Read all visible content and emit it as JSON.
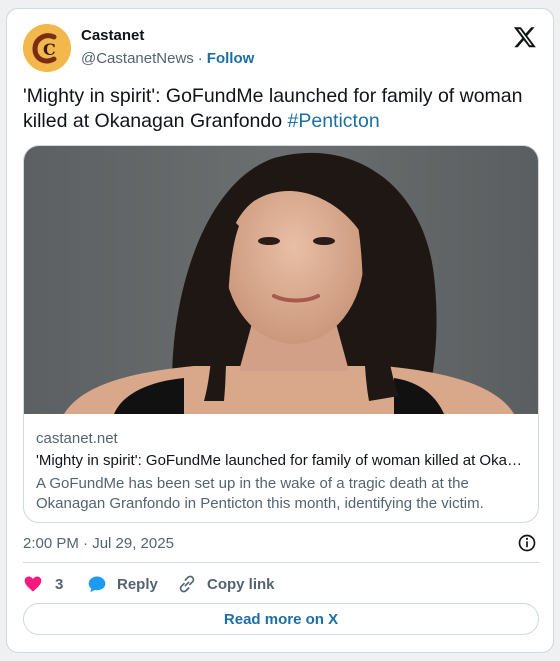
{
  "author": {
    "name": "Castanet",
    "handle": "@CastanetNews",
    "separator": "·",
    "follow_label": "Follow",
    "avatar_letter": "C"
  },
  "tweet": {
    "text": "'Mighty in spirit': GoFundMe launched for family of woman killed at Okanagan Granfondo ",
    "hashtag": "#Penticton"
  },
  "link_card": {
    "domain": "castanet.net",
    "title": "'Mighty in spirit': GoFundMe launched for family of woman killed at Okanagan Granfondo #Penticton",
    "description": "A GoFundMe has been set up in the wake of a tragic death at the Okanagan Granfondo in Penticton this month, identifying the victim."
  },
  "timestamp": "2:00 PM · Jul 29, 2025",
  "actions": {
    "like_count": "3",
    "reply_label": "Reply",
    "copy_label": "Copy link"
  },
  "read_more_label": "Read more on X",
  "colors": {
    "accent": "#1d6fa3",
    "like": "#f91880",
    "reply": "#1d9bf0",
    "avatar_bg": "#f2b84b"
  },
  "icons": [
    "castanet-logo-icon",
    "x-logo-icon",
    "info-icon",
    "heart-icon",
    "reply-bubble-icon",
    "link-icon"
  ]
}
